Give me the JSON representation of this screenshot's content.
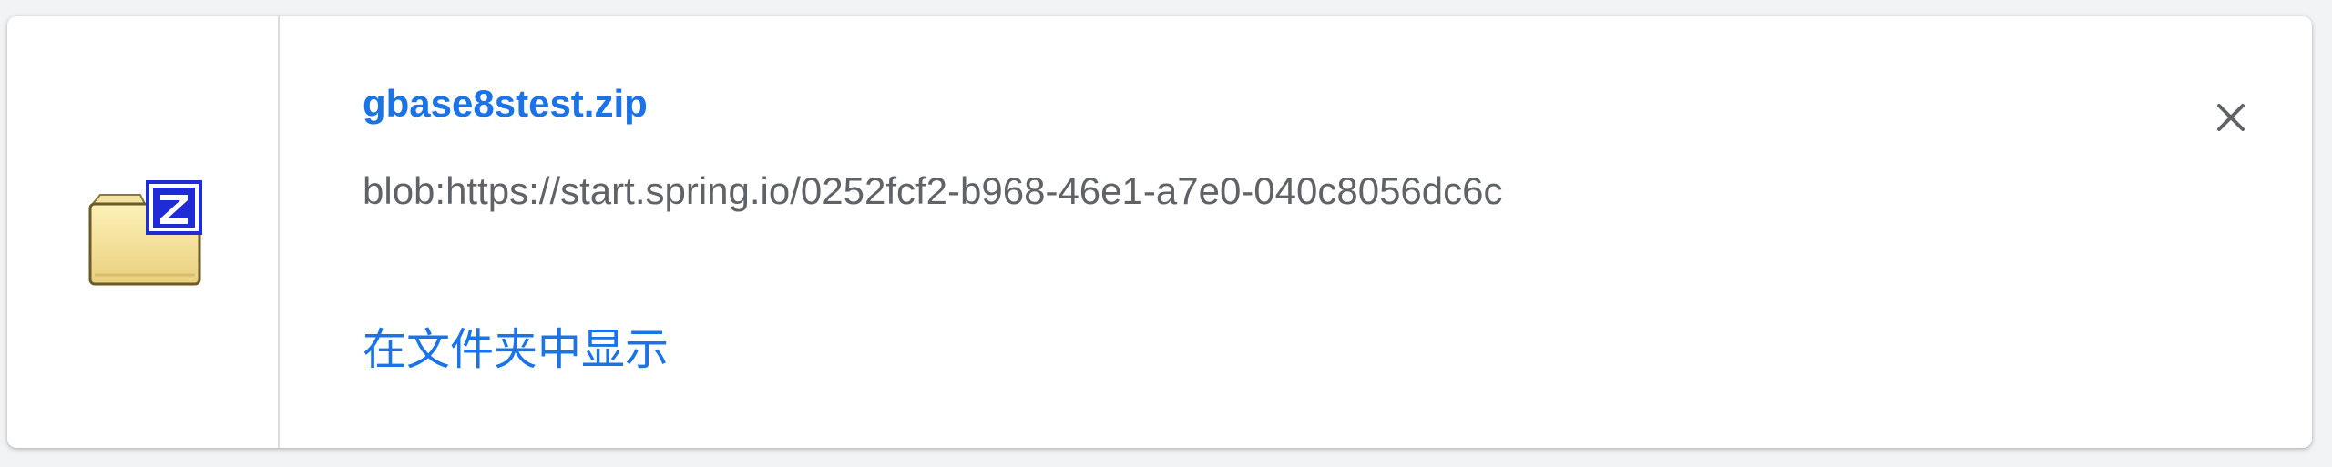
{
  "download": {
    "filename": "gbase8stest.zip",
    "url": "blob:https://start.spring.io/0252fcf2-b968-46e1-a7e0-040c8056dc6c",
    "show_in_folder_label": "在文件夹中显示",
    "file_icon": "zip-folder-icon",
    "close_icon": "close-icon"
  },
  "colors": {
    "link": "#1a73e8",
    "secondary_text": "#5f6368",
    "divider": "#dadce0",
    "background": "#f1f3f4",
    "card": "#ffffff"
  }
}
